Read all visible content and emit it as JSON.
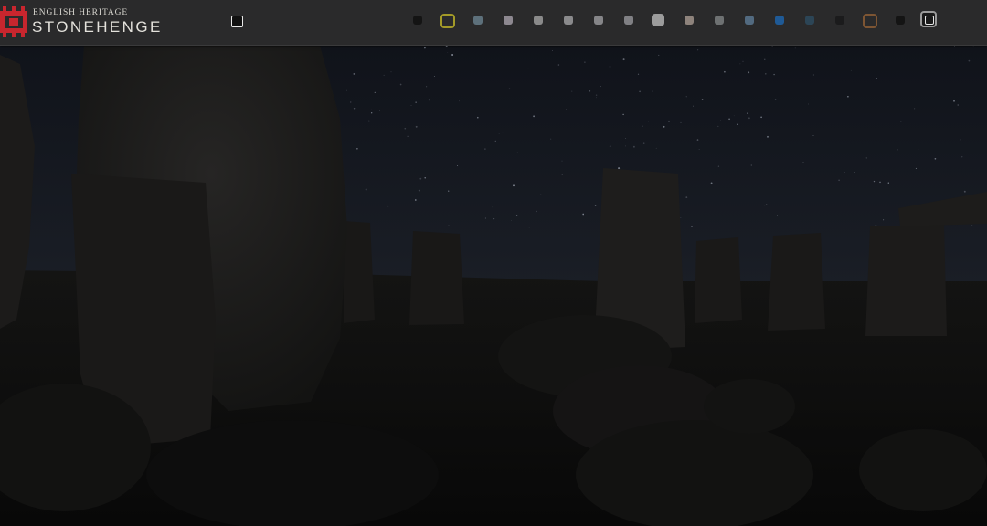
{
  "brand": {
    "org": "ENGLISH HERITAGE",
    "site": "STONEHENGE",
    "logo_color": "#c8262e"
  },
  "toolbar": {
    "view_toggle_icon": "square-outline-icon",
    "swatches": [
      {
        "name": "swatch-black",
        "color": "#141414",
        "style": "fill"
      },
      {
        "name": "swatch-olive",
        "color": "#a39a28",
        "style": "ring"
      },
      {
        "name": "swatch-slate",
        "color": "#5d707b",
        "style": "fill"
      },
      {
        "name": "swatch-lavender-gray",
        "color": "#8d8890",
        "style": "fill"
      },
      {
        "name": "swatch-gray",
        "color": "#8a8a8a",
        "style": "fill"
      },
      {
        "name": "swatch-gray-2",
        "color": "#8a8a8c",
        "style": "fill"
      },
      {
        "name": "swatch-gray-3",
        "color": "#858588",
        "style": "fill"
      },
      {
        "name": "swatch-gray-4",
        "color": "#808084",
        "style": "fill"
      },
      {
        "name": "swatch-light-gray",
        "color": "#9c9c9c",
        "style": "big"
      },
      {
        "name": "swatch-taupe",
        "color": "#8e837c",
        "style": "fill"
      },
      {
        "name": "swatch-gray-5",
        "color": "#6e7172",
        "style": "fill"
      },
      {
        "name": "swatch-steel-blue",
        "color": "#526a80",
        "style": "fill"
      },
      {
        "name": "swatch-blue",
        "color": "#1f5a96",
        "style": "fill"
      },
      {
        "name": "swatch-dark-teal",
        "color": "#2c4556",
        "style": "fill"
      },
      {
        "name": "swatch-charcoal",
        "color": "#1b1b1c",
        "style": "fill"
      },
      {
        "name": "swatch-brown",
        "color": "#7d5533",
        "style": "ring"
      },
      {
        "name": "swatch-near-black",
        "color": "#141414",
        "style": "fill"
      },
      {
        "name": "swatch-selected",
        "color": "#9a9a9a",
        "style": "selected"
      }
    ]
  },
  "scene": {
    "description_icon": "stonehenge-night-panorama",
    "sky_color": "#1b1f27",
    "stone_color": "#1d1c1b"
  }
}
